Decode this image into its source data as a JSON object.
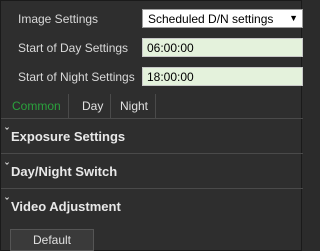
{
  "settings": {
    "image_settings": {
      "label": "Image Settings",
      "value": "Scheduled D/N settings"
    },
    "start_of_day": {
      "label": "Start of Day Settings",
      "value": "06:00:00"
    },
    "start_of_night": {
      "label": "Start of Night Settings",
      "value": "18:00:00"
    }
  },
  "tabs": [
    {
      "label": "Common",
      "active": true
    },
    {
      "label": "Day",
      "active": false
    },
    {
      "label": "Night",
      "active": false
    }
  ],
  "sections": [
    {
      "title": "Exposure Settings"
    },
    {
      "title": "Day/Night Switch"
    },
    {
      "title": "Video Adjustment"
    }
  ],
  "default_button": {
    "label": "Default"
  },
  "icons": {
    "select_arrow": "dropdown-arrow-icon",
    "section_chevron": "chevron-down-icon"
  },
  "colors": {
    "active_tab": "#2aa13c",
    "input_bg": "#e4f2dc",
    "panel_bg": "#2e2e2e"
  }
}
